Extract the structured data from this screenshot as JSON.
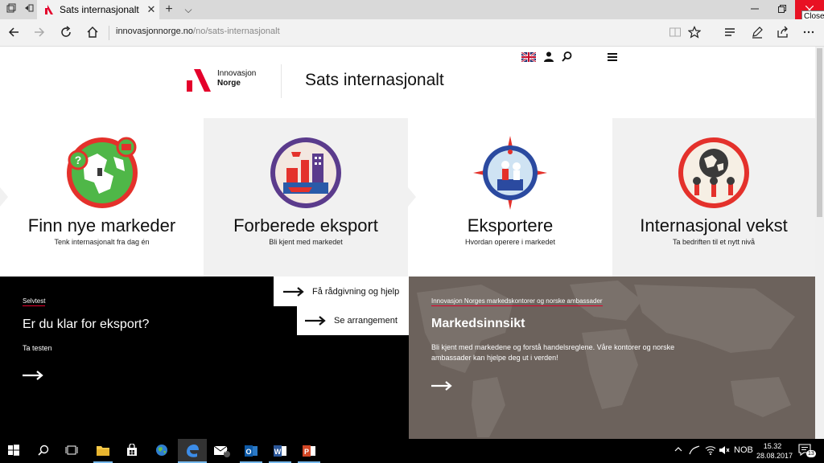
{
  "browser": {
    "tab_title": "Sats internasjonalt",
    "tab_close": "✕",
    "new_tab": "+",
    "tab_menu": "⌵",
    "url_domain": "innovasjonnorge.no",
    "url_path": "/no/sats-internasjonalt",
    "close_tooltip": "Close"
  },
  "site": {
    "logo_line1": "Innovasjon",
    "logo_line2": "Norge",
    "title": "Sats internasjonalt"
  },
  "tiles": [
    {
      "title": "Finn nye markeder",
      "subtitle": "Tenk internasjonalt fra dag én"
    },
    {
      "title": "Forberede eksport",
      "subtitle": "Bli kjent med markedet"
    },
    {
      "title": "Eksportere",
      "subtitle": "Hvordan operere i markedet"
    },
    {
      "title": "Internasjonal vekst",
      "subtitle": "Ta bedriften til et nytt nivå"
    }
  ],
  "selftest": {
    "label": "Selvtest",
    "title": "Er du klar for eksport?",
    "link": "Ta testen"
  },
  "cta": {
    "advice": "Få rådgivning og hjelp",
    "events": "Se arrangement"
  },
  "insight": {
    "label": "Innovasjon Norges markedskontorer og norske ambassader",
    "title": "Markedsinnsikt",
    "text": "Bli kjent med markedene og forstå handelsreglene. Våre kontorer og norske ambassader kan hjelpe deg ut i verden!"
  },
  "taskbar": {
    "mail_badge": "7",
    "language": "NOB",
    "time": "15.32",
    "date": "28.08.2017",
    "notifications": "13"
  },
  "colors": {
    "brand_red": "#e4002b",
    "insight_bg": "#6c625c",
    "tile_gray": "#f1f1f1"
  }
}
